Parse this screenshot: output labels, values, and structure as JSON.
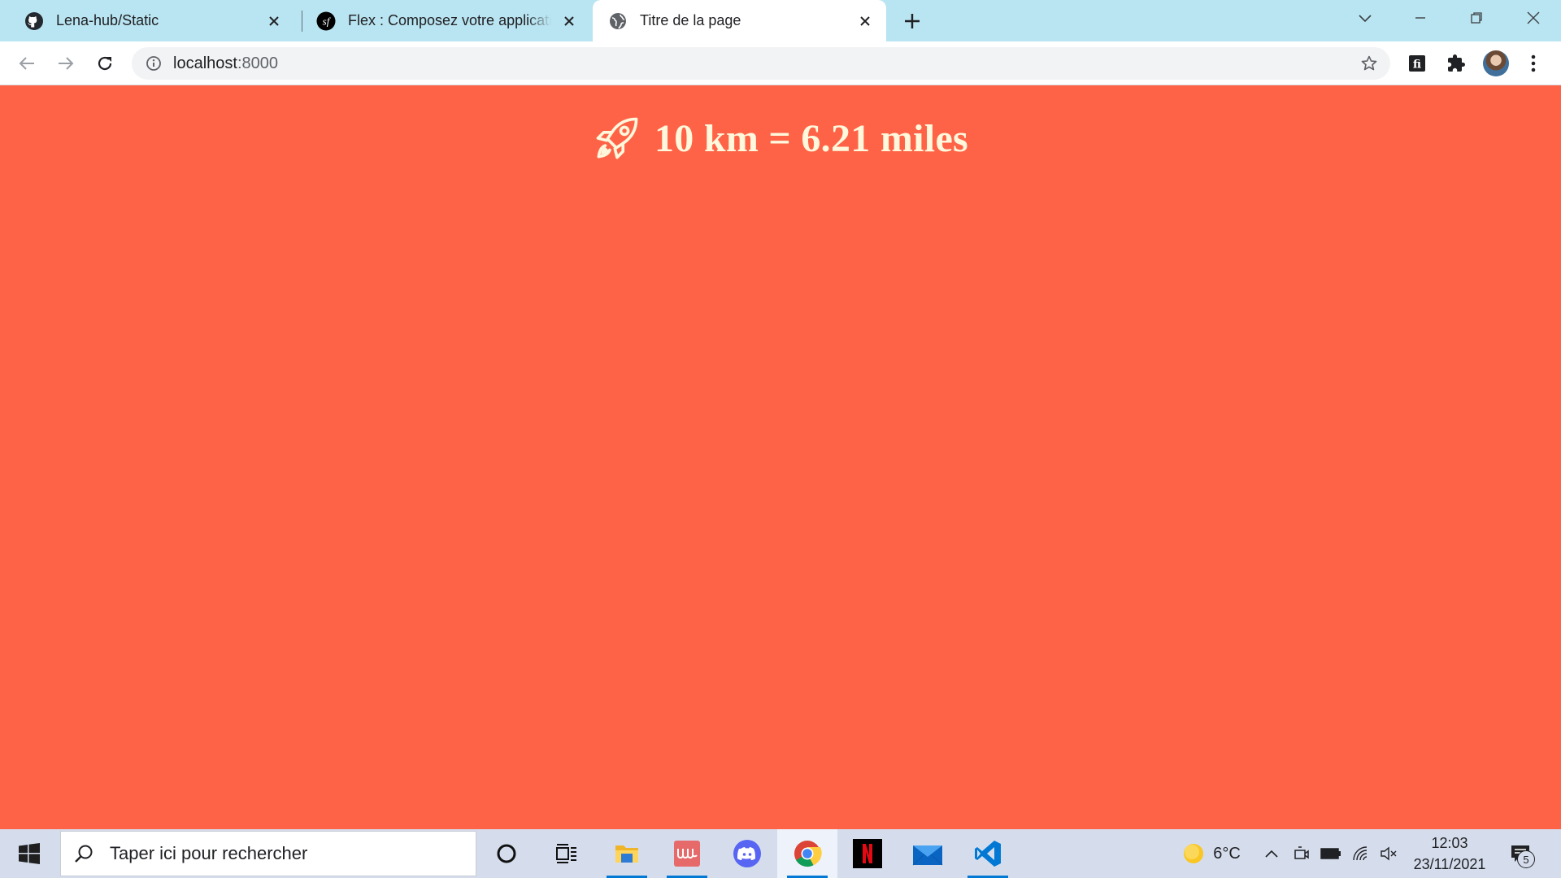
{
  "browser": {
    "tabs": [
      {
        "title": "Lena-hub/Static",
        "icon": "github-icon",
        "active": false
      },
      {
        "title": "Flex : Composez votre application",
        "icon": "symfony-icon",
        "active": false
      },
      {
        "title": "Titre de la page",
        "icon": "globe-icon",
        "active": true
      }
    ],
    "url_host": "localhost",
    "url_port": ":8000"
  },
  "page": {
    "headline": "10 km = 6.21 miles",
    "headline_icon": "rocket-icon",
    "background_color": "#ff6347",
    "text_color": "#fff8dc"
  },
  "taskbar": {
    "search_placeholder": "Taper ici pour rechercher",
    "apps": [
      "cortana-icon",
      "task-view-icon",
      "file-explorer-icon",
      "app-icon",
      "discord-icon",
      "chrome-icon",
      "netflix-icon",
      "mail-icon",
      "vscode-icon"
    ],
    "weather": "6°C",
    "time": "12:03",
    "date": "23/11/2021",
    "notification_count": "5"
  }
}
